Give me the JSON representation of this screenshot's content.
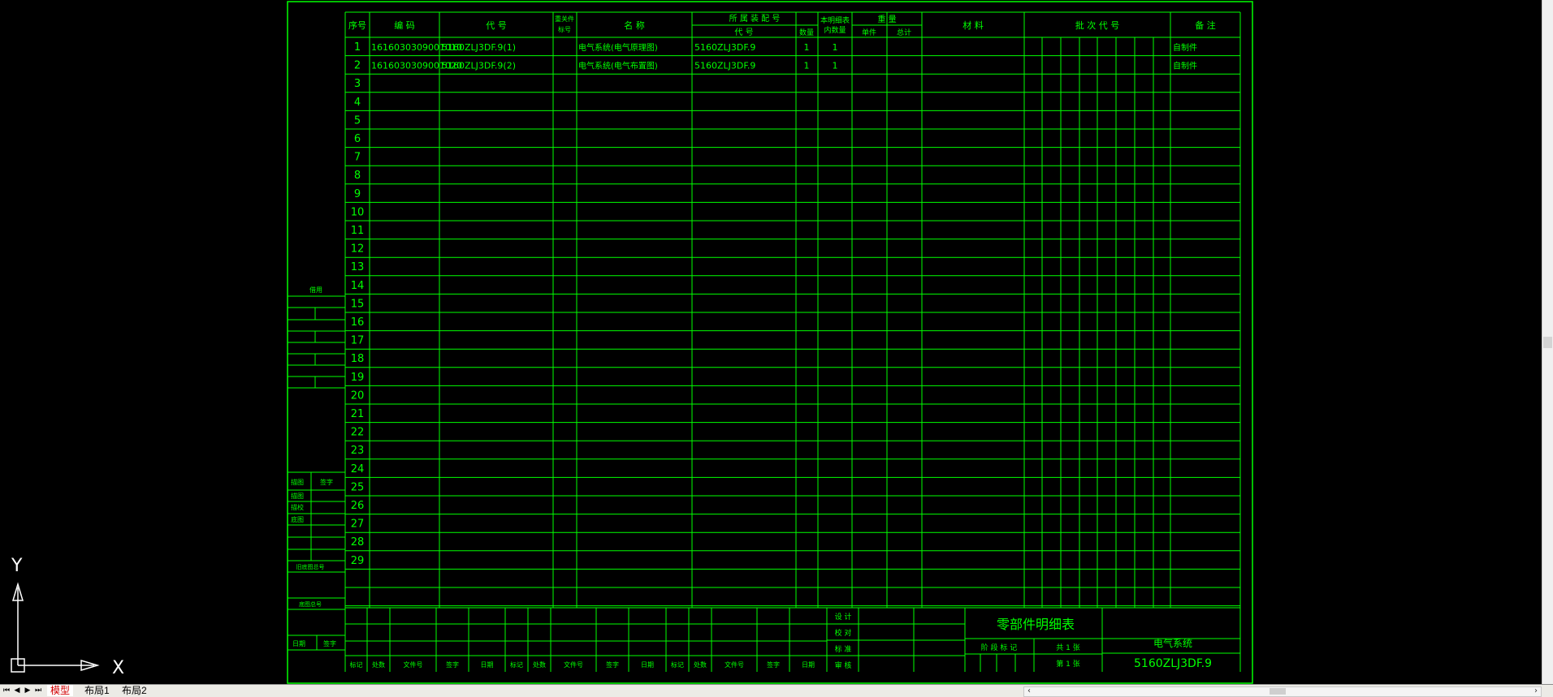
{
  "table": {
    "headers": {
      "seq": "序号",
      "code": "编  码",
      "drawing_no": "代        号",
      "key_mark": "重关件标号",
      "name": "名          称",
      "parent_assembly": "所 属 装 配 号",
      "parent_code": "代    号",
      "parent_qty": "数量",
      "table_qty": "本明细表内数量",
      "weight": "重    量",
      "weight_single": "单件",
      "weight_total": "总计",
      "material": "材        料",
      "batch_code": "批    次    代    号",
      "remark": "备    注"
    },
    "rows": [
      {
        "seq": "1",
        "code": "1616030309001010",
        "drawing_no": "5160ZLJ3DF.9(1)",
        "name": "电气系统(电气原理图)",
        "parent_code": "5160ZLJ3DF.9",
        "parent_qty": "1",
        "table_qty": "1",
        "remark": "自制件"
      },
      {
        "seq": "2",
        "code": "1616030309001020",
        "drawing_no": "5160ZLJ3DF.9(2)",
        "name": "电气系统(电气布置图)",
        "parent_code": "5160ZLJ3DF.9",
        "parent_qty": "1",
        "table_qty": "1",
        "remark": "自制件"
      },
      {
        "seq": "3"
      },
      {
        "seq": "4"
      },
      {
        "seq": "5"
      },
      {
        "seq": "6"
      },
      {
        "seq": "7"
      },
      {
        "seq": "8"
      },
      {
        "seq": "9"
      },
      {
        "seq": "10"
      },
      {
        "seq": "11"
      },
      {
        "seq": "12"
      },
      {
        "seq": "13"
      },
      {
        "seq": "14"
      },
      {
        "seq": "15"
      },
      {
        "seq": "16"
      },
      {
        "seq": "17"
      },
      {
        "seq": "18"
      },
      {
        "seq": "19"
      },
      {
        "seq": "20"
      },
      {
        "seq": "21"
      },
      {
        "seq": "22"
      },
      {
        "seq": "23"
      },
      {
        "seq": "24"
      },
      {
        "seq": "25"
      },
      {
        "seq": "26"
      },
      {
        "seq": "27"
      },
      {
        "seq": "28"
      },
      {
        "seq": "29"
      }
    ]
  },
  "left_block": {
    "top_label": "借用",
    "sign_header_1": "描图",
    "sign_header_2": "签字",
    "role_1": "描图",
    "role_2": "描校",
    "role_3": "底图",
    "bottom_label_1": "旧底图总号",
    "bottom_label_2": "底图总号",
    "bottom_row_1": "日期",
    "bottom_row_2": "签字"
  },
  "title_block": {
    "rev_labels": [
      "标记",
      "处数",
      "文件号",
      "签字",
      "日期",
      "标记",
      "处数",
      "文件号",
      "签字",
      "日期",
      "标记",
      "处数",
      "文件号",
      "签字",
      "日期"
    ],
    "approvals": [
      "设 计",
      "校 对",
      "标 准",
      "审 核"
    ],
    "sheet_title": "零部件明细表",
    "stage_label": "阶 段 标 记",
    "sheets_total": "共 1 张",
    "sheet_current": "第 1 张",
    "assembly_name": "电气系统",
    "assembly_code": "5160ZLJ3DF.9"
  },
  "ucs": {
    "x_label": "X",
    "y_label": "Y"
  },
  "tabs": {
    "model": "模型",
    "layout1": "布局1",
    "layout2": "布局2"
  },
  "colors": {
    "line": "#00ff00",
    "text": "#00ff00",
    "background": "#000000",
    "active_tab": "#d00000"
  }
}
